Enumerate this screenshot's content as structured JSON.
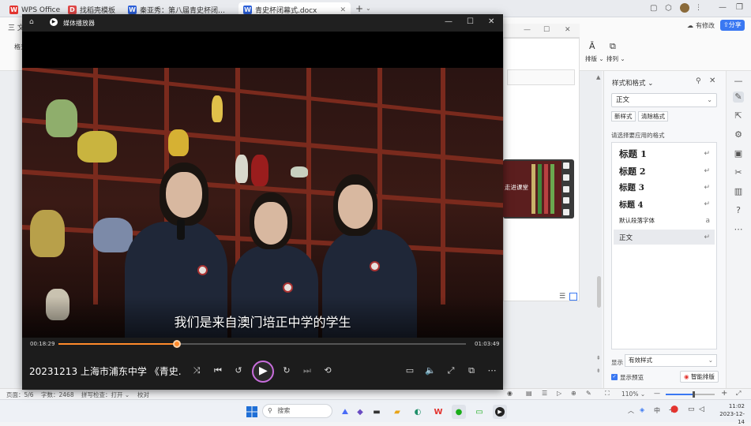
{
  "tabs": [
    {
      "label": "WPS Office",
      "icon": "wps-logo-icon",
      "color": "#e3342f"
    },
    {
      "label": "找稻壳模板",
      "icon": "docer-icon",
      "color": "#e04848"
    },
    {
      "label": "秦亚秀：第八届青史杯闭幕式主持稿",
      "icon": "word-doc-icon",
      "color": "#2b5fd9"
    },
    {
      "label": "青史杯闭幕式.docx",
      "icon": "word-doc-icon",
      "color": "#2b5fd9"
    }
  ],
  "toolbar": {
    "menu_label": "三 文",
    "left_label": "格式",
    "layout_label": "排版",
    "arrange_label": "排列",
    "changes_label": "有修改",
    "share_label": "分享"
  },
  "player": {
    "app_title": "媒体播放器",
    "subtitle": "我们是来自澳门培正中学的学生",
    "current_time": "00:18:29",
    "total_time": "01:03:49",
    "progress": 0.29,
    "media_title": "20231213 上海市浦东中学 《青史...",
    "colors": {
      "accent": "#ff8a2b"
    }
  },
  "thumbnail": {
    "label": "走进课堂"
  },
  "style_panel": {
    "title": "样式和格式",
    "current_style": "正文",
    "new_style_btn": "新样式",
    "clear_format_btn": "清除格式",
    "apply_prompt": "请选择要应用的格式",
    "styles": [
      {
        "label": "标题 1",
        "marker": "↵"
      },
      {
        "label": "标题 2",
        "marker": "↵"
      },
      {
        "label": "标题 3",
        "marker": "↵"
      },
      {
        "label": "标题 4",
        "marker": "↵"
      },
      {
        "label": "默认段落字体",
        "marker": "a"
      },
      {
        "label": "正文",
        "marker": "↵"
      }
    ],
    "show_label": "显示",
    "show_value": "有效样式",
    "preview_label": "显示预览",
    "smart_layout_btn": "智能排版"
  },
  "statusbar": {
    "page": "页面：5/6",
    "words": "字数：2468",
    "spell": "拼写检查：打开",
    "proof": "校对",
    "zoom": "110%",
    "zoom_level": 0.55
  },
  "taskbar": {
    "search_placeholder": "搜索",
    "ime": "中",
    "time": "11:02",
    "date": "2023-12-14"
  }
}
